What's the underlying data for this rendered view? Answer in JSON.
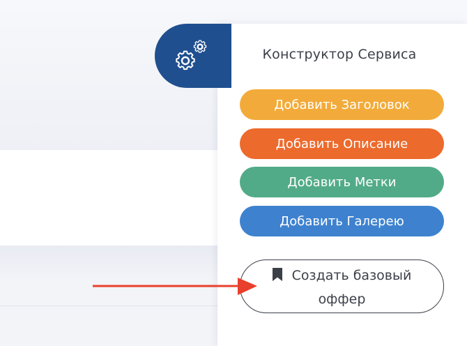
{
  "panel": {
    "title": "Конструктор Сервиса",
    "gear_icon": "gears-icon",
    "buttons": {
      "add_title": "Добавить Заголовок",
      "add_description": "Добавить Описание",
      "add_tags": "Добавить Метки",
      "add_gallery": "Добавить Галерею"
    },
    "offer_button": {
      "line1": "Создать базовый",
      "line2": "оффер",
      "icon": "bookmark-icon"
    }
  },
  "annotation": {
    "icon": "arrow-right-icon",
    "color": "#e8402c"
  },
  "colors": {
    "gear_tab": "#1f4f8f",
    "add_title": "#f2ab3a",
    "add_description": "#ec6a2c",
    "add_tags": "#52ab88",
    "add_gallery": "#3e82cf"
  }
}
